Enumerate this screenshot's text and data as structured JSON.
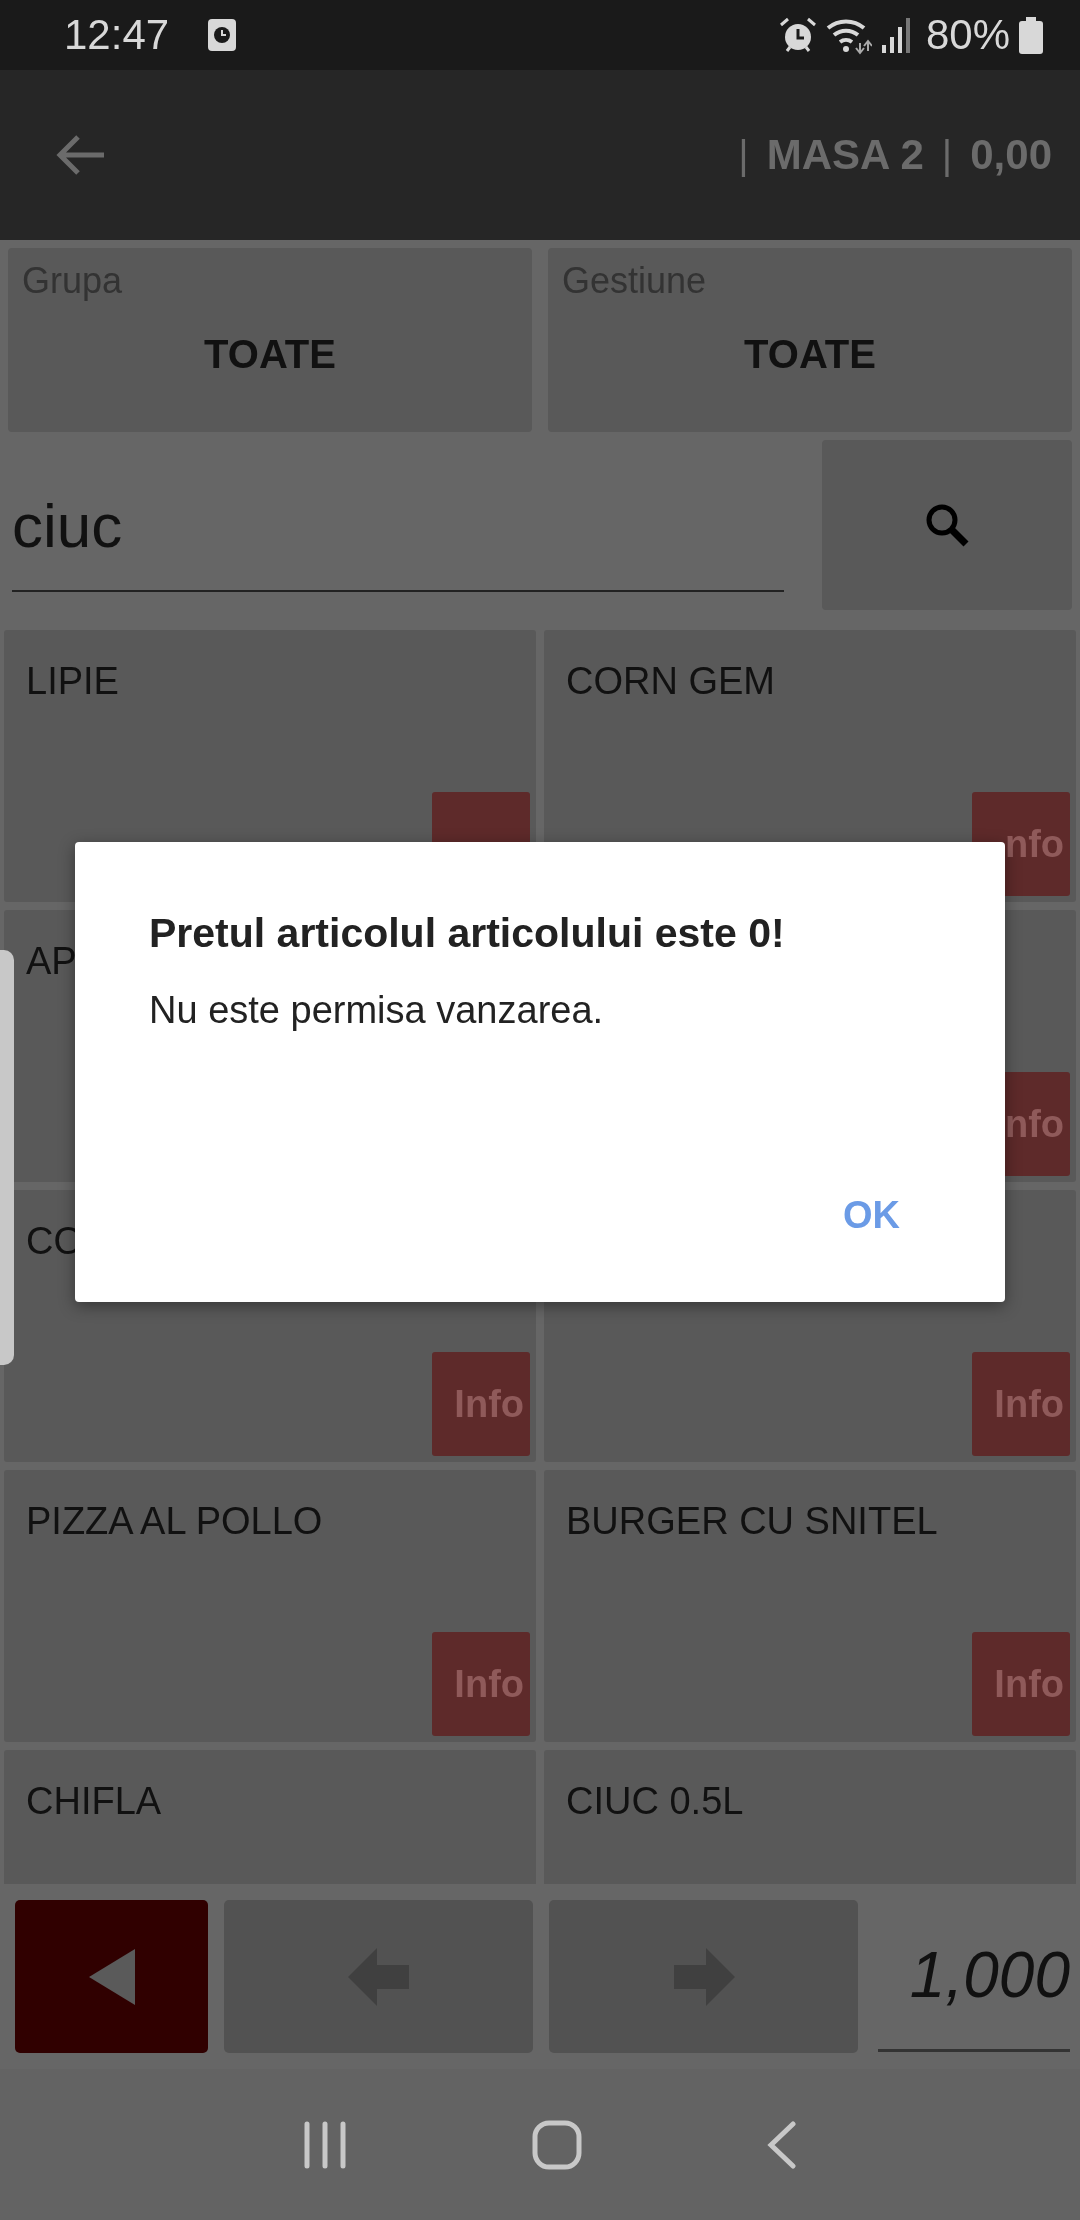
{
  "status_bar": {
    "time": "12:47",
    "battery": "80%"
  },
  "toolbar": {
    "segments": [
      "|",
      "MASA 2",
      "|",
      "0,00"
    ]
  },
  "filters": [
    {
      "label": "Grupa",
      "value": "TOATE"
    },
    {
      "label": "Gestiune",
      "value": "TOATE"
    }
  ],
  "search": {
    "value": "ciuc"
  },
  "products": [
    {
      "name": "LIPIE",
      "info_button": true
    },
    {
      "name": "CORN GEM",
      "info_button": true,
      "info": "nfo"
    },
    {
      "name": "AP"
    },
    {
      "info_button": true,
      "info": "nfo"
    },
    {
      "name": "CO",
      "info_button": true,
      "info": "Info"
    },
    {
      "info_button": true,
      "info": "Info"
    },
    {
      "name": "PIZZA AL POLLO",
      "info_button": true,
      "info": "Info"
    },
    {
      "name": "BURGER CU SNITEL",
      "info_button": true,
      "info": "Info"
    },
    {
      "name": "CHIFLA"
    },
    {
      "name": "CIUC 0.5L"
    }
  ],
  "quantity": {
    "value": "1,000"
  },
  "dialog": {
    "title": "Pretul articolul articolului este 0!",
    "message": "Nu este permisa vanzarea.",
    "button": "OK"
  }
}
